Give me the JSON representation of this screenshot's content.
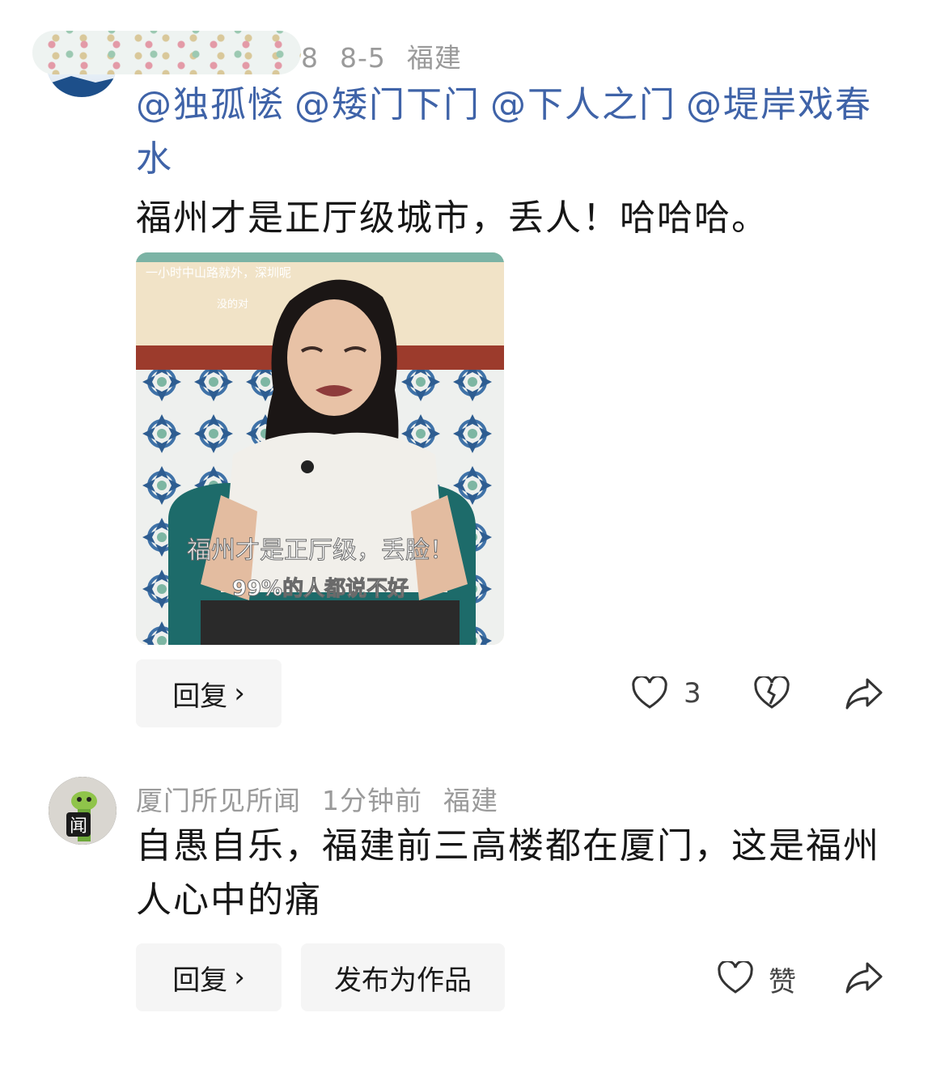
{
  "comments": [
    {
      "meta_visible": [
        "8",
        "8-5",
        "福建"
      ],
      "mentions": [
        "@独孤恡",
        "@矮门下门",
        "@下人之门",
        "@堤岸戏春水"
      ],
      "text": "福州才是正厅级城市，丢人！哈哈哈。",
      "image": {
        "top_caption": "一小时中山路就外，深圳呢",
        "top_caption2": "没的对",
        "caption_line1": "福州才是正厅级，丢脸！",
        "caption_line2": "99%的人都说不好"
      },
      "actions": {
        "reply_label": "回复",
        "like_count": "3"
      }
    },
    {
      "username": "厦门所见所闻",
      "time": "1分钟前",
      "location": "福建",
      "avatar_text": "闻",
      "text": "自愚自乐，福建前三高楼都在厦门，这是福州人心中的痛",
      "actions": {
        "reply_label": "回复",
        "publish_label": "发布为作品",
        "like_label": "赞"
      }
    }
  ],
  "icons": [
    "heart-icon",
    "dislike-heart-icon",
    "share-icon",
    "chevron-right-icon"
  ],
  "colors": {
    "mention": "#3f63a8",
    "meta": "#9a9a9a",
    "pill_bg": "#f5f5f5"
  }
}
